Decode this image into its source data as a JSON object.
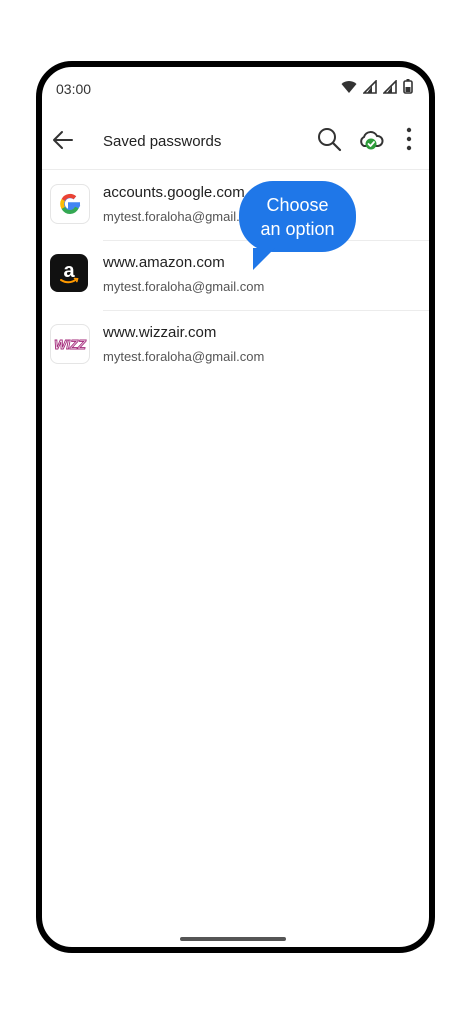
{
  "status_bar": {
    "time": "03:00"
  },
  "app_bar": {
    "title": "Saved passwords"
  },
  "passwords": [
    {
      "site": "accounts.google.com",
      "user": "mytest.foraloha@gmail.com",
      "icon": "google-logo"
    },
    {
      "site": "www.amazon.com",
      "user": "mytest.foraloha@gmail.com",
      "icon": "amazon-logo"
    },
    {
      "site": "www.wizzair.com",
      "user": "mytest.foraloha@gmail.com",
      "icon": "wizzair-logo"
    }
  ],
  "tooltip": {
    "line1": "Choose",
    "line2": "an option"
  },
  "colors": {
    "accent": "#1f77e8",
    "sync_ok": "#2e9c3a"
  }
}
